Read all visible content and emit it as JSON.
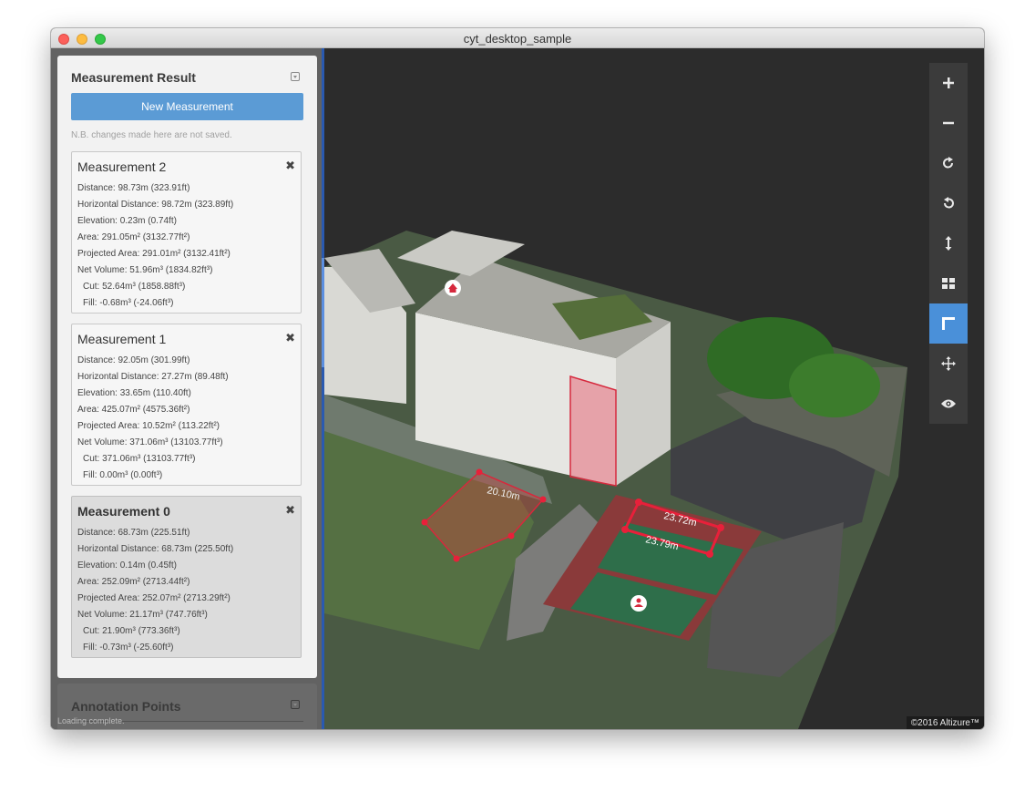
{
  "window": {
    "title": "cyt_desktop_sample"
  },
  "measurement_panel": {
    "title": "Measurement Result",
    "new_button": "New Measurement",
    "note": "N.B. changes made here are not saved.",
    "measurements": [
      {
        "title": "Measurement 2",
        "rows": [
          "Distance:  98.73m (323.91ft)",
          "Horizontal Distance:  98.72m (323.89ft)",
          "Elevation:  0.23m (0.74ft)",
          "Area:  291.05m² (3132.77ft²)",
          "Projected Area:  291.01m² (3132.41ft²)",
          "Net Volume:  51.96m³ (1834.82ft³)",
          "Cut:  52.64m³ (1858.88ft³)",
          "Fill:  -0.68m³ (-24.06ft³)"
        ]
      },
      {
        "title": "Measurement 1",
        "rows": [
          "Distance:  92.05m (301.99ft)",
          "Horizontal Distance:  27.27m (89.48ft)",
          "Elevation:  33.65m (110.40ft)",
          "Area:  425.07m² (4575.36ft²)",
          "Projected Area:  10.52m² (113.22ft²)",
          "Net Volume:  371.06m³ (13103.77ft³)",
          "Cut:  371.06m³ (13103.77ft³)",
          "Fill:  0.00m³ (0.00ft³)"
        ]
      },
      {
        "title": "Measurement 0",
        "rows": [
          "Distance:  68.73m (225.51ft)",
          "Horizontal Distance:  68.73m (225.50ft)",
          "Elevation:  0.14m (0.45ft)",
          "Area:  252.09m² (2713.44ft²)",
          "Projected Area:  252.07m² (2713.29ft²)",
          "Net Volume:  21.17m³ (747.76ft³)",
          "Cut:  21.90m³ (773.36ft³)",
          "Fill:  -0.73m³ (-25.60ft³)"
        ]
      }
    ]
  },
  "annotation_panel": {
    "title": "Annotation Points"
  },
  "status": "Loading complete.",
  "map_labels": {
    "m1": "20.10m",
    "m2a": "23.72m",
    "m2b": "23.79m"
  },
  "toolbar": {
    "tools": [
      "zoom-in",
      "zoom-out",
      "rotate-clockwise",
      "rotate-counterclockwise",
      "vertical-measure",
      "grid-view",
      "measure-ruler",
      "pan-move",
      "visibility"
    ],
    "active": "measure-ruler",
    "accent": "#4a90d9"
  },
  "copyright": "©2016 Altizure™"
}
